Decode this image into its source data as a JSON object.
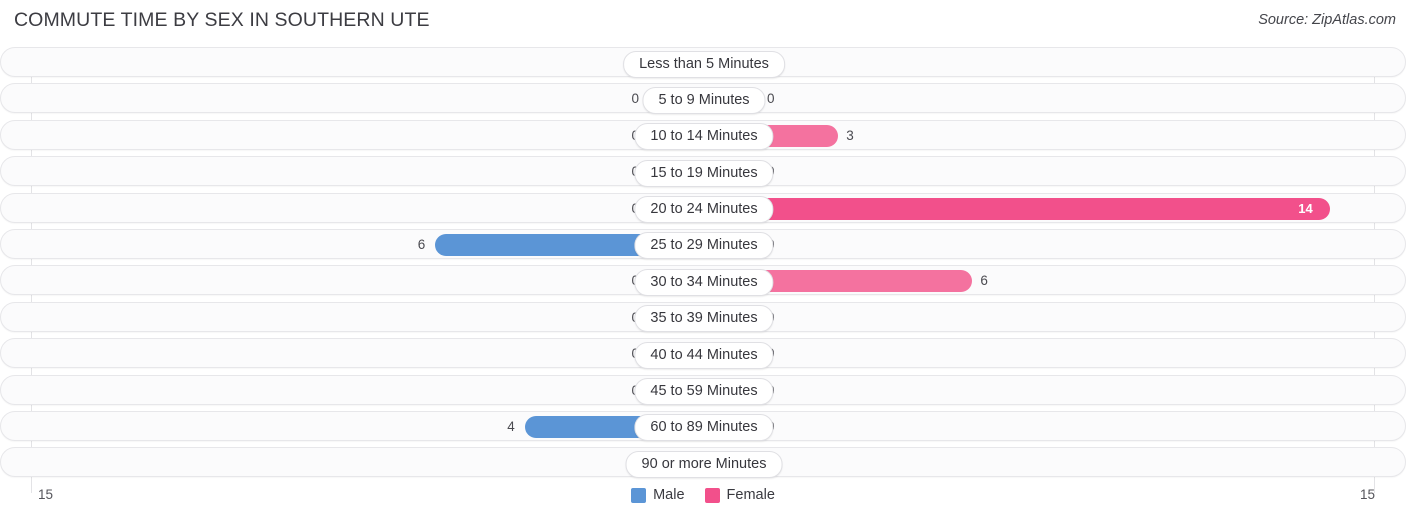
{
  "header": {
    "title": "COMMUTE TIME BY SEX IN SOUTHERN UTE",
    "source": "Source: ZipAtlas.com"
  },
  "axis": {
    "left_max_label": "15",
    "right_max_label": "15"
  },
  "legend": {
    "items": [
      {
        "label": "Male",
        "color": "#5b95d6",
        "swatch": "male"
      },
      {
        "label": "Female",
        "color": "#f2508b",
        "swatch": "female"
      }
    ]
  },
  "colors": {
    "male_active": "#5b95d6",
    "male_zero": "#a9c9ec",
    "female_active": "#f4729f",
    "female_hot": "#f2508b",
    "female_zero": "#f7a9c5",
    "row_background": "#fbfbfc",
    "row_border": "#e7e7ea",
    "gridline": "#e3e3e6"
  },
  "chart_data": {
    "type": "bar",
    "title": "COMMUTE TIME BY SEX IN SOUTHERN UTE",
    "subtitle": "",
    "orientation": "horizontal-diverging",
    "xlabel": "",
    "ylabel": "",
    "xlim": [
      15,
      15
    ],
    "grid": true,
    "legend_position": "bottom-center",
    "categories": [
      "Less than 5 Minutes",
      "5 to 9 Minutes",
      "10 to 14 Minutes",
      "15 to 19 Minutes",
      "20 to 24 Minutes",
      "25 to 29 Minutes",
      "30 to 34 Minutes",
      "35 to 39 Minutes",
      "40 to 44 Minutes",
      "45 to 59 Minutes",
      "60 to 89 Minutes",
      "90 or more Minutes"
    ],
    "series": [
      {
        "name": "Male",
        "direction": "left",
        "values": [
          0,
          0,
          0,
          0,
          0,
          6,
          0,
          0,
          0,
          0,
          4,
          0
        ]
      },
      {
        "name": "Female",
        "direction": "right",
        "values": [
          0,
          0,
          3,
          0,
          14,
          0,
          6,
          0,
          0,
          0,
          0,
          0
        ]
      }
    ]
  },
  "rows": [
    {
      "category": "Less than 5 Minutes",
      "male": "0",
      "female": "0"
    },
    {
      "category": "5 to 9 Minutes",
      "male": "0",
      "female": "0"
    },
    {
      "category": "10 to 14 Minutes",
      "male": "0",
      "female": "3"
    },
    {
      "category": "15 to 19 Minutes",
      "male": "0",
      "female": "0"
    },
    {
      "category": "20 to 24 Minutes",
      "male": "0",
      "female": "14"
    },
    {
      "category": "25 to 29 Minutes",
      "male": "6",
      "female": "0"
    },
    {
      "category": "30 to 34 Minutes",
      "male": "0",
      "female": "6"
    },
    {
      "category": "35 to 39 Minutes",
      "male": "0",
      "female": "0"
    },
    {
      "category": "40 to 44 Minutes",
      "male": "0",
      "female": "0"
    },
    {
      "category": "45 to 59 Minutes",
      "male": "0",
      "female": "0"
    },
    {
      "category": "60 to 89 Minutes",
      "male": "4",
      "female": "0"
    },
    {
      "category": "90 or more Minutes",
      "male": "0",
      "female": "0"
    }
  ]
}
